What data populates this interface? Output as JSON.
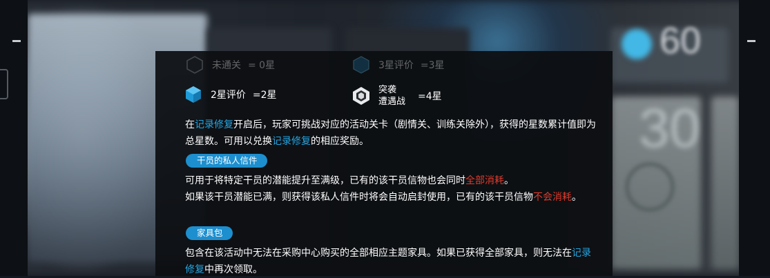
{
  "background": {
    "stage_number_top": "60",
    "stage_number_mid": "30"
  },
  "ratings": [
    {
      "label": "未通关",
      "value": "= 0星",
      "icon": "hexagon-outline-icon"
    },
    {
      "label": "3星评价",
      "value": "=3星",
      "icon": "hexagon-dark-blue-icon"
    },
    {
      "label": "2星评价",
      "value": "=2星",
      "icon": "cube-blue-icon"
    },
    {
      "label_line1": "突袭",
      "label_line2": "遭遇战",
      "value": "=4星",
      "icon": "hexagon-white-ring-icon"
    }
  ],
  "sections": {
    "intro": {
      "t1": "在",
      "link1": "记录修复",
      "t2": "开启后，玩家可挑战对应的活动关卡（剧情关、训练关除外），获得的星数累计值即为总星数。可用以兑换",
      "link2": "记录修复",
      "t3": "的相应奖励。"
    },
    "letter": {
      "tag": "干员的私人信件",
      "t1": "可用于将特定干员的潜能提升至满级，已有的该干员信物也会同时",
      "red1": "全部消耗",
      "t2": "。",
      "t3": "如果该干员潜能已满，则获得该私人信件时将会自动启封使用，已有的该干员信物",
      "red2": "不会消耗",
      "t4": "。"
    },
    "furniture": {
      "tag": "家具包",
      "t1": "包含在该活动中无法在采购中心购买的全部相应主题家具。如果已获得全部家具，则无法在",
      "link1": "记录修复",
      "t2": "中再次领取。"
    }
  },
  "colors": {
    "accent_blue": "#23a6e3",
    "pill_blue": "#1d8fcf",
    "warning_red": "#e03a2c"
  }
}
